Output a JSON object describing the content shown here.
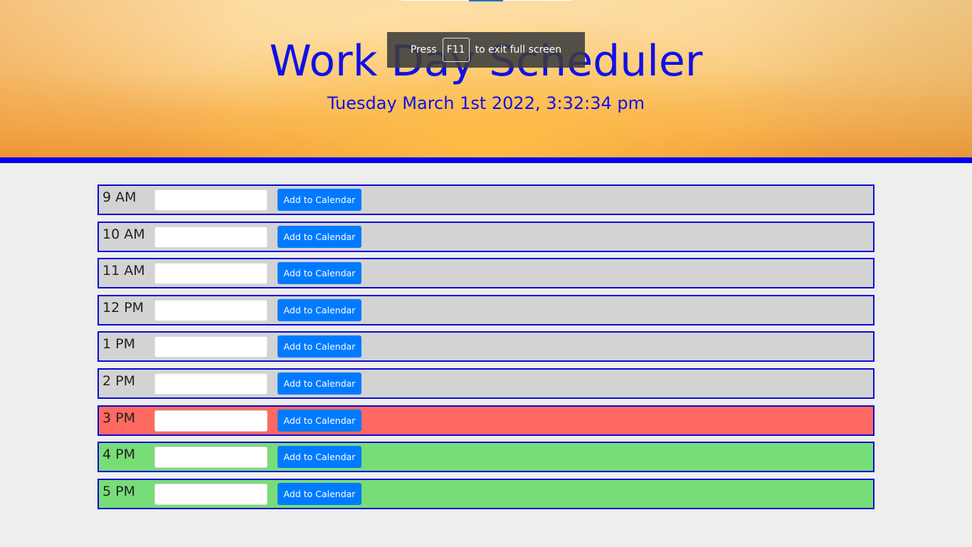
{
  "header": {
    "title": "Work Day Scheduler",
    "current_date": "Tuesday March 1st 2022, 3:32:34 pm"
  },
  "fullscreen_toast": {
    "prefix": "Press",
    "key": "F11",
    "suffix": "to exit full screen"
  },
  "colors": {
    "title": "#1010e6",
    "rule": "#0000ee",
    "past": "#d3d3d3",
    "present": "#ff6961",
    "future": "#77dd77",
    "button": "#007bff"
  },
  "schedule": [
    {
      "hour": "9 AM",
      "state": "past",
      "task": "",
      "button_label": "Add to Calendar"
    },
    {
      "hour": "10 AM",
      "state": "past",
      "task": "",
      "button_label": "Add to Calendar"
    },
    {
      "hour": "11 AM",
      "state": "past",
      "task": "",
      "button_label": "Add to Calendar"
    },
    {
      "hour": "12 PM",
      "state": "past",
      "task": "",
      "button_label": "Add to Calendar"
    },
    {
      "hour": "1 PM",
      "state": "past",
      "task": "",
      "button_label": "Add to Calendar"
    },
    {
      "hour": "2 PM",
      "state": "past",
      "task": "",
      "button_label": "Add to Calendar"
    },
    {
      "hour": "3 PM",
      "state": "present",
      "task": "",
      "button_label": "Add to Calendar"
    },
    {
      "hour": "4 PM",
      "state": "future",
      "task": "",
      "button_label": "Add to Calendar"
    },
    {
      "hour": "5 PM",
      "state": "future",
      "task": "",
      "button_label": "Add to Calendar"
    }
  ]
}
